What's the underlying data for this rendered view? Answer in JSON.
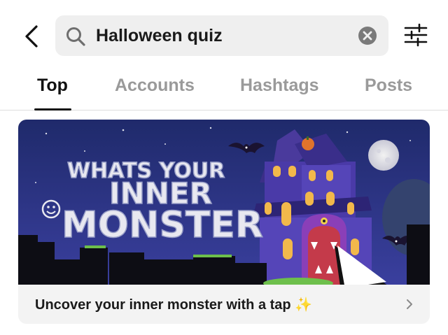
{
  "search": {
    "value": "Halloween quiz",
    "placeholder": ""
  },
  "tabs": [
    {
      "label": "Top",
      "active": true
    },
    {
      "label": "Accounts",
      "active": false
    },
    {
      "label": "Hashtags",
      "active": false
    },
    {
      "label": "Posts",
      "active": false
    }
  ],
  "result_card": {
    "banner_title_line1": "WHATS YOUR",
    "banner_title_line2": "INNER",
    "banner_title_line3": "MONSTER",
    "caption": "Uncover your inner monster with a tap ✨"
  },
  "icons": {
    "back": "chevron-left-icon",
    "search": "search-icon",
    "clear": "close-circle-icon",
    "filter": "sliders-icon",
    "caption_arrow": "chevron-right-icon"
  },
  "colors": {
    "search_bg": "#efefef",
    "tab_active": "#111111",
    "tab_inactive": "#9a9a9a",
    "banner_sky": "#2b2f7a",
    "house": "#3d2f8f",
    "window_glow": "#f2b84b",
    "grass": "#6dbf4b"
  }
}
